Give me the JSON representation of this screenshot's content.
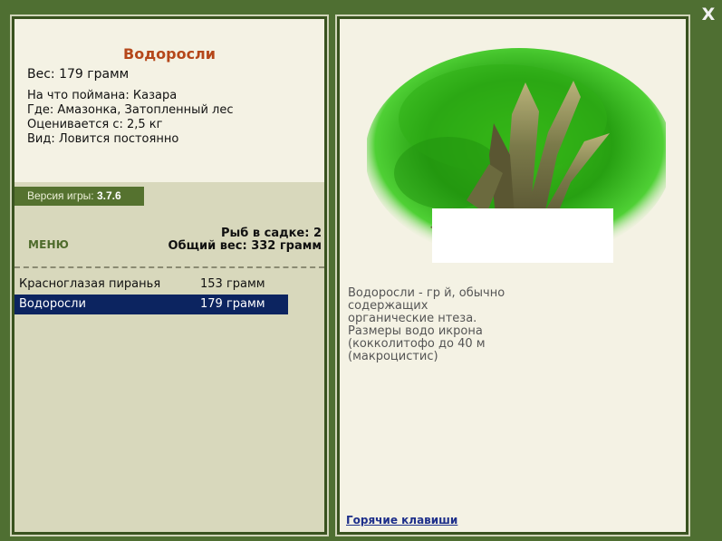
{
  "close_label": "X",
  "fish": {
    "title": "Водоросли",
    "weight": "Вес: 179 грамм",
    "bait": "На что поймана: Казара",
    "location": "Где: Амазонка, Затопленный лес",
    "value": "Оценивается с: 2,5 кг",
    "kind": "Вид: Ловится постоянно"
  },
  "version": {
    "label": "Версия игры:",
    "number": "3.7.6"
  },
  "menu_label": "МЕНЮ",
  "keep": {
    "count": "Рыб в садке: 2",
    "total": "Общий вес: 332 грамм"
  },
  "catch_list": [
    {
      "name": "Красноглазая пиранья",
      "weight": "153 грамм"
    },
    {
      "name": "Водоросли",
      "weight": "179 грамм"
    }
  ],
  "description_lines": [
    "Водоросли - гр                                   й, обычно",
    "содержащих                                        ",
    "органические                                    нтеза.",
    "Размеры водо                                    икрона",
    "(кокколитофо                                    до 40 м",
    "(макроцистис)"
  ],
  "hotkeys_label": "Горячие клавиши",
  "colors": {
    "accent_title": "#b5471a",
    "selection": "#0c2460",
    "panel_green": "#55722f"
  }
}
